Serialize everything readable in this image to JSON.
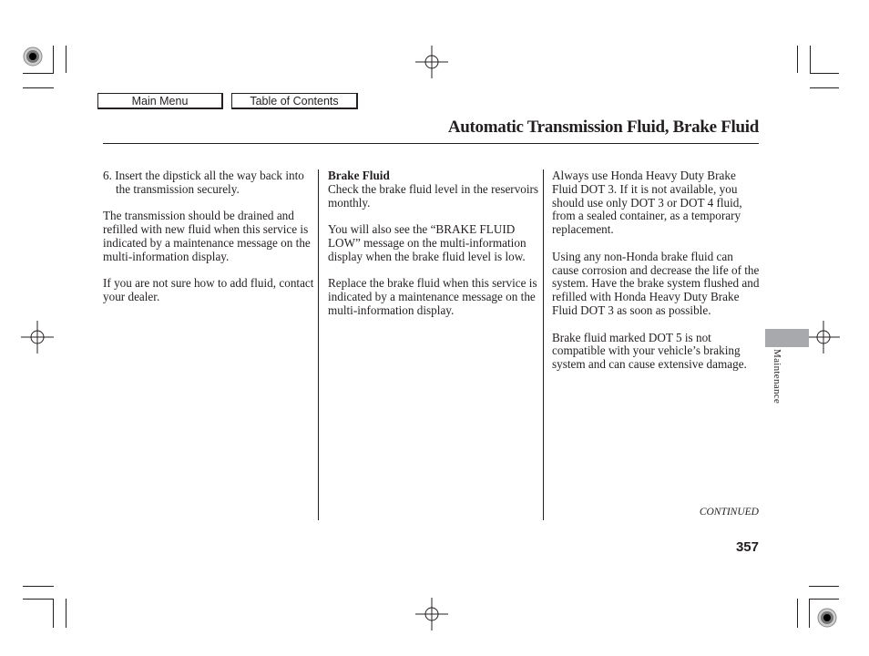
{
  "nav": {
    "main_menu": "Main Menu",
    "table_of_contents": "Table of Contents"
  },
  "header": {
    "title": "Automatic Transmission Fluid, Brake Fluid"
  },
  "columns": {
    "left": {
      "step6": "6. Insert the dipstick all the way back into the transmission securely.",
      "para1": "The transmission should be drained and refilled with new fluid when this service is indicated by a maintenance message on the multi-information display.",
      "para2": "If you are not sure how to add fluid, contact your dealer."
    },
    "middle": {
      "heading": "Brake Fluid",
      "para1": "Check the brake fluid level in the reservoirs monthly.",
      "para2": "You will also see the “BRAKE FLUID LOW” message on the multi-information display when the brake fluid level is low.",
      "para3": "Replace the brake fluid when this service is indicated by a maintenance message on the multi-information display."
    },
    "right": {
      "para1": "Always use Honda Heavy Duty Brake Fluid DOT 3. If it is not available, you should use only DOT 3 or DOT 4 fluid, from a sealed container, as a temporary replacement.",
      "para2": "Using any non-Honda brake fluid can cause corrosion and decrease the life of the system. Have the brake system flushed and refilled with Honda Heavy Duty Brake Fluid DOT 3 as soon as possible.",
      "para3": "Brake fluid marked DOT 5 is not compatible with your vehicle’s braking system and can cause extensive damage."
    }
  },
  "side_tab": {
    "label": "Maintenance",
    "color": "#a7a9ac"
  },
  "footer": {
    "continued": "CONTINUED",
    "page_number": "357"
  }
}
